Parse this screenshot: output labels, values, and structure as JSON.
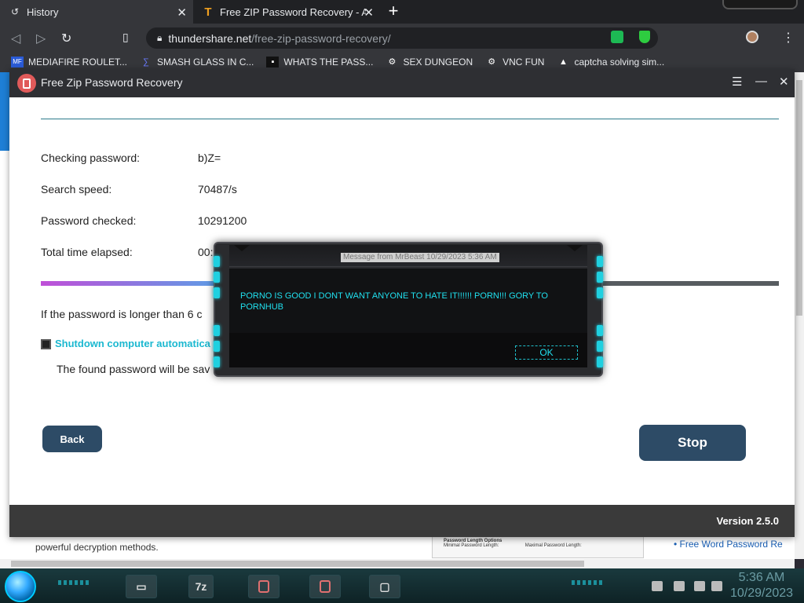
{
  "browser": {
    "tabs": [
      {
        "label": "History",
        "icon": "history-icon"
      },
      {
        "label": "Free ZIP Password Recovery - A sc",
        "icon": "thundershare-icon"
      }
    ],
    "url_domain": "thundershare.net",
    "url_path": "/free-zip-password-recovery/",
    "bookmarks": [
      {
        "label": "MEDIAFIRE ROULET..."
      },
      {
        "label": "SMASH GLASS IN C..."
      },
      {
        "label": "WHATS THE PASS..."
      },
      {
        "label": "SEX DUNGEON"
      },
      {
        "label": "VNC FUN"
      },
      {
        "label": "captcha solving sim..."
      }
    ]
  },
  "background_page": {
    "text": "powerful decryption methods.",
    "thumb_title": "Password Length Options",
    "thumb_min": "Minimal Password Length:",
    "thumb_max": "Maximal Password Length:",
    "link": "• Free Word Password Re"
  },
  "app": {
    "title": "Free Zip Password Recovery",
    "rows": [
      {
        "label": "Checking password:",
        "value": "b)Z="
      },
      {
        "label": "Search speed:",
        "value": "70487/s"
      },
      {
        "label": "Password checked:",
        "value": "10291200"
      },
      {
        "label": "Total time elapsed:",
        "value": "00:"
      }
    ],
    "hint": "If the password is longer than 6 c",
    "checkbox_label": "Shutdown computer automatica",
    "found_text": "The found password will be sav",
    "back_label": "Back",
    "stop_label": "Stop",
    "version": "Version 2.5.0"
  },
  "dialog": {
    "title": "Message from MrBeast 10/29/2023 5:36 AM",
    "message": "PORNO IS GOOD I DONT WANT ANYONE TO HATE IT!!!!!! PORN!!! GORY TO PORNHUB",
    "ok_label": "OK"
  },
  "taskbar": {
    "app_label": "7z",
    "clock_time": "5:36 AM",
    "clock_date": "10/29/2023"
  }
}
